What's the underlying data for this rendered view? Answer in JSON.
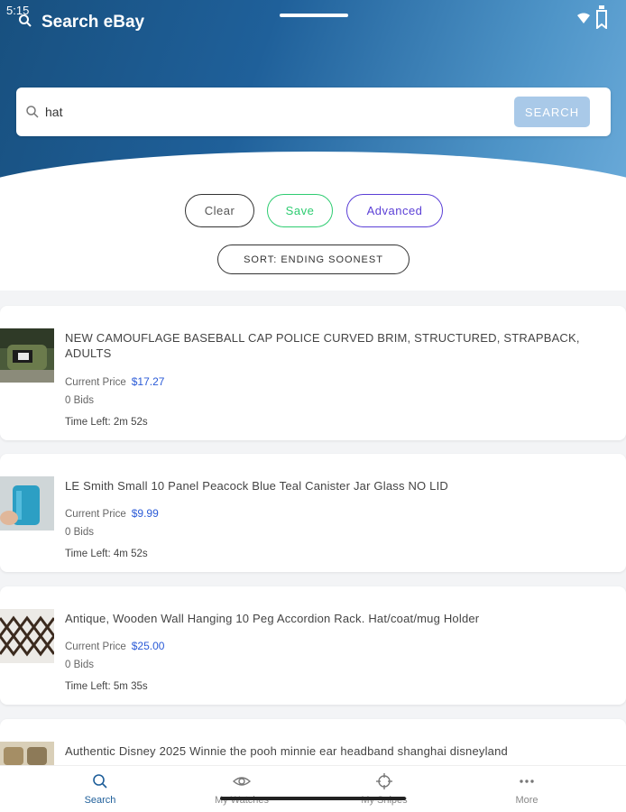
{
  "status": {
    "time": "5:15"
  },
  "header": {
    "title": "Search eBay"
  },
  "search": {
    "value": "hat",
    "button_label": "SEARCH"
  },
  "actions": {
    "clear": "Clear",
    "save": "Save",
    "advanced": "Advanced",
    "sort": "SORT: ENDING SOONEST"
  },
  "listings": [
    {
      "title": "NEW CAMOUFLAGE BASEBALL CAP POLICE CURVED BRIM, STRUCTURED, STRAPBACK, ADULTS",
      "price_label": "Current Price",
      "price": "$17.27",
      "bids": "0 Bids",
      "time_label": "Time Left:",
      "time_left": "2m 52s"
    },
    {
      "title": "LE Smith Small 10 Panel Peacock Blue Teal Canister Jar Glass NO LID",
      "price_label": "Current Price",
      "price": "$9.99",
      "bids": "0 Bids",
      "time_label": "Time Left:",
      "time_left": "4m 52s"
    },
    {
      "title": "Antique, Wooden Wall Hanging 10 Peg Accordion Rack. Hat/coat/mug Holder",
      "price_label": "Current Price",
      "price": "$25.00",
      "bids": "0 Bids",
      "time_label": "Time Left:",
      "time_left": "5m 35s"
    },
    {
      "title": "Authentic Disney 2025 Winnie the pooh minnie ear headband shanghai disneyland"
    }
  ],
  "nav": {
    "search": "Search",
    "watches": "My Watches",
    "snipes": "My Snipes",
    "more": "More"
  },
  "colors": {
    "header": "#1f609a",
    "price": "#2b5bd7",
    "save": "#2ecc71",
    "advanced": "#5b3fd6"
  }
}
